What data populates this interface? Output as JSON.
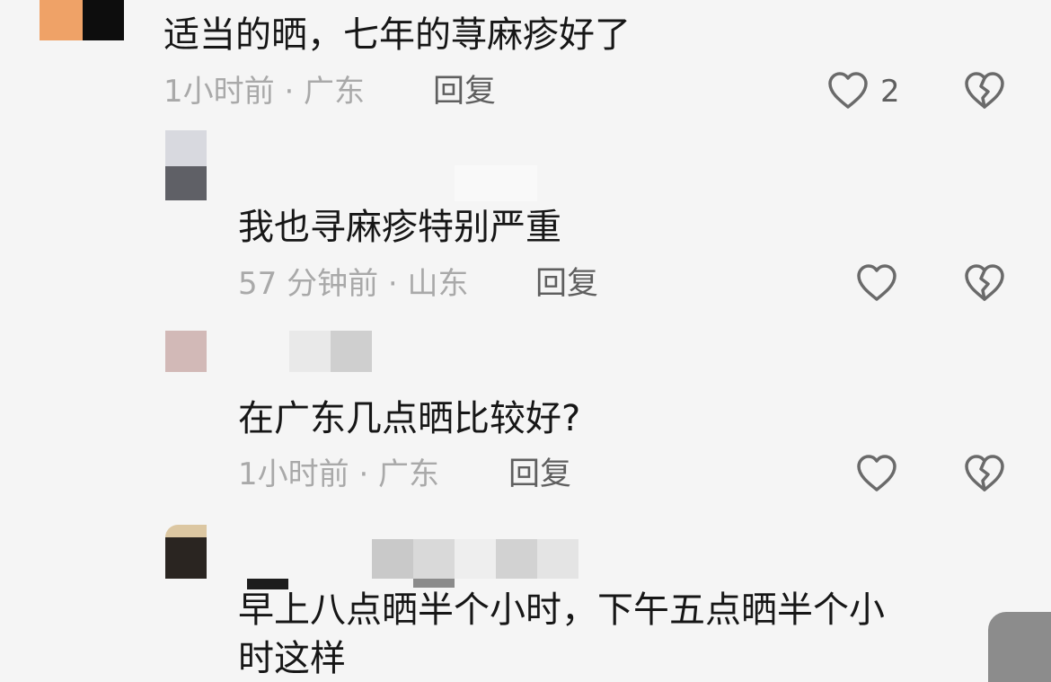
{
  "comments": [
    {
      "text": "适当的晒，七年的荨麻疹好了",
      "meta": "1小时前 · 广东",
      "reply_label": "回复",
      "likes": "2"
    },
    {
      "text": "我也寻麻疹特别严重",
      "meta": "57 分钟前 · 山东",
      "reply_label": "回复"
    },
    {
      "text": "在广东几点晒比较好?",
      "meta": "1小时前 · 广东",
      "reply_label": "回复"
    },
    {
      "text_line_1": "早上八点晒半个小时，下午五点晒半个小",
      "text_line_2": "时这样"
    }
  ],
  "icons": {
    "like": "heart-outline-icon",
    "dislike": "broken-heart-outline-icon"
  },
  "colors": {
    "background": "#f5f5f5",
    "text": "#161616",
    "meta": "#a9a9a9",
    "action": "#5f5f5f"
  }
}
